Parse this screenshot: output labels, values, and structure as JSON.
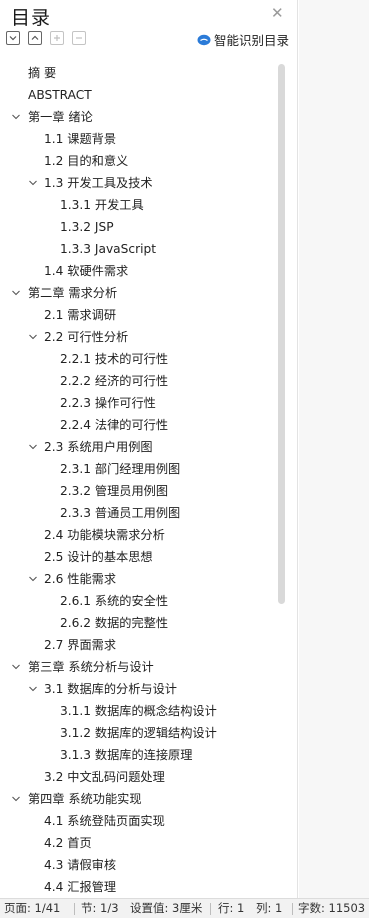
{
  "panel": {
    "title": "目录",
    "smart_toc_label": "智能识别目录",
    "accent_color": "#2b7bd8"
  },
  "toc": [
    {
      "level": 0,
      "label": "摘    要",
      "expandable": false
    },
    {
      "level": 0,
      "label": "ABSTRACT",
      "expandable": false
    },
    {
      "level": 0,
      "label": "第一章  绪论",
      "expandable": true
    },
    {
      "level": 1,
      "label": "1.1 课题背景",
      "expandable": false
    },
    {
      "level": 1,
      "label": "1.2 目的和意义",
      "expandable": false
    },
    {
      "level": 1,
      "label": "1.3 开发工具及技术",
      "expandable": true
    },
    {
      "level": 2,
      "label": "1.3.1 开发工具",
      "expandable": false
    },
    {
      "level": 2,
      "label": "1.3.2 JSP",
      "expandable": false
    },
    {
      "level": 2,
      "label": "1.3.3 JavaScript",
      "expandable": false
    },
    {
      "level": 1,
      "label": "1.4 软硬件需求",
      "expandable": false
    },
    {
      "level": 0,
      "label": "第二章  需求分析",
      "expandable": true
    },
    {
      "level": 1,
      "label": "2.1 需求调研",
      "expandable": false
    },
    {
      "level": 1,
      "label": "2.2 可行性分析",
      "expandable": true
    },
    {
      "level": 2,
      "label": "2.2.1 技术的可行性",
      "expandable": false
    },
    {
      "level": 2,
      "label": "2.2.2 经济的可行性",
      "expandable": false
    },
    {
      "level": 2,
      "label": "2.2.3 操作可行性",
      "expandable": false
    },
    {
      "level": 2,
      "label": "2.2.4 法律的可行性",
      "expandable": false
    },
    {
      "level": 1,
      "label": "2.3 系统用户用例图",
      "expandable": true
    },
    {
      "level": 2,
      "label": "2.3.1 部门经理用例图",
      "expandable": false
    },
    {
      "level": 2,
      "label": "2.3.2 管理员用例图",
      "expandable": false
    },
    {
      "level": 2,
      "label": "2.3.3 普通员工用例图",
      "expandable": false
    },
    {
      "level": 1,
      "label": "2.4 功能模块需求分析",
      "expandable": false
    },
    {
      "level": 1,
      "label": "2.5 设计的基本思想",
      "expandable": false
    },
    {
      "level": 1,
      "label": "2.6 性能需求",
      "expandable": true
    },
    {
      "level": 2,
      "label": "2.6.1 系统的安全性",
      "expandable": false
    },
    {
      "level": 2,
      "label": "2.6.2 数据的完整性",
      "expandable": false
    },
    {
      "level": 1,
      "label": "2.7 界面需求",
      "expandable": false
    },
    {
      "level": 0,
      "label": "第三章  系统分析与设计",
      "expandable": true
    },
    {
      "level": 1,
      "label": "3.1 数据库的分析与设计",
      "expandable": true
    },
    {
      "level": 2,
      "label": "3.1.1 数据库的概念结构设计",
      "expandable": false
    },
    {
      "level": 2,
      "label": "3.1.2 数据库的逻辑结构设计",
      "expandable": false
    },
    {
      "level": 2,
      "label": "3.1.3 数据库的连接原理",
      "expandable": false
    },
    {
      "level": 1,
      "label": "3.2 中文乱码问题处理",
      "expandable": false
    },
    {
      "level": 0,
      "label": "第四章  系统功能实现",
      "expandable": true
    },
    {
      "level": 1,
      "label": "4.1 系统登陆页面实现",
      "expandable": false
    },
    {
      "level": 1,
      "label": "4.2 首页",
      "expandable": false
    },
    {
      "level": 1,
      "label": "4.3 请假审核",
      "expandable": false
    },
    {
      "level": 1,
      "label": "4.4 汇报管理",
      "expandable": false
    }
  ],
  "status_bar": {
    "page": "页面: 1/41",
    "section": "节: 1/3",
    "setting": "设置值: 3厘米",
    "line": "行: 1",
    "column": "列: 1",
    "word_count": "字数: 11503"
  }
}
